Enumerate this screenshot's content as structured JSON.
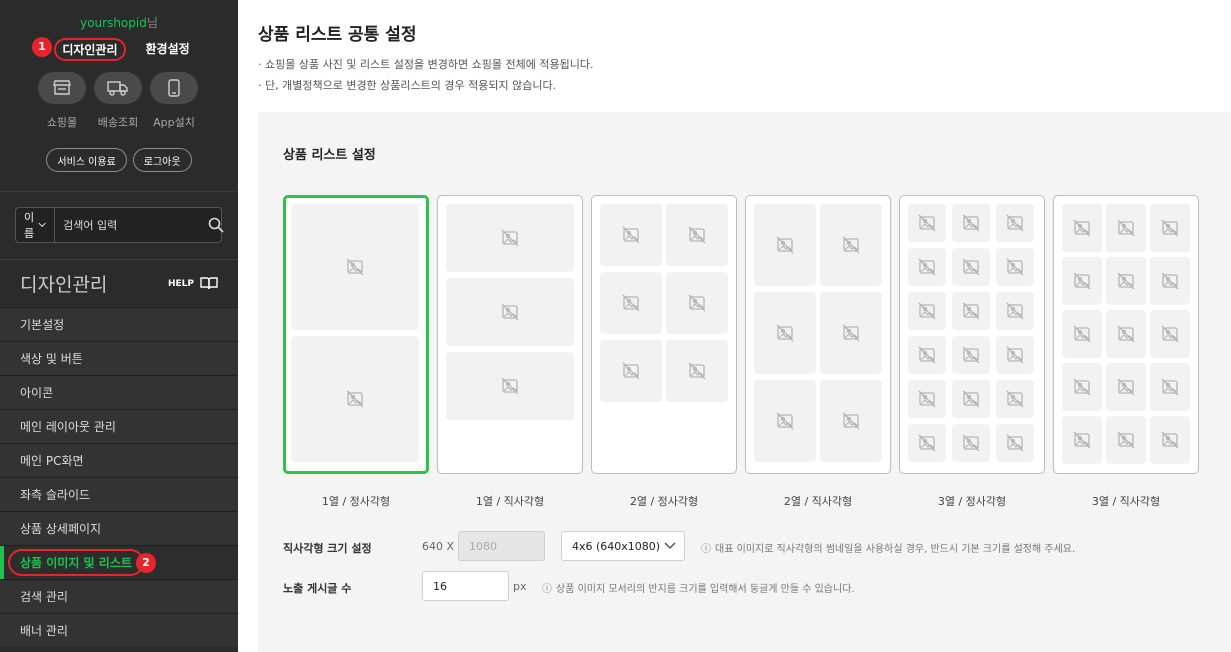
{
  "sidebar": {
    "username": "yourshopid",
    "username_suffix": "님",
    "tabs": [
      {
        "label": "디자인관리",
        "badge": "1"
      },
      {
        "label": "환경설정"
      }
    ],
    "quick": [
      {
        "icon": "shop-icon",
        "label": "쇼핑몰"
      },
      {
        "icon": "truck-icon",
        "label": "배송조회"
      },
      {
        "icon": "phone-icon",
        "label": "App설치"
      }
    ],
    "pills": [
      "서비스 이용료",
      "로그아웃"
    ],
    "search": {
      "select": "이름",
      "placeholder": "검색어 입력"
    },
    "section_title": "디자인관리",
    "help_label": "HELP",
    "menu": [
      {
        "label": "기본설정"
      },
      {
        "label": "색상 및 버튼"
      },
      {
        "label": "아이콘"
      },
      {
        "label": "메인 레이아웃 관리"
      },
      {
        "label": "메인 PC화면"
      },
      {
        "label": "좌측 슬라이드"
      },
      {
        "label": "상품 상세페이지"
      },
      {
        "label": "상품 이미지 및 리스트",
        "badge": "2"
      },
      {
        "label": "검색 관리"
      },
      {
        "label": "배너 관리"
      }
    ]
  },
  "main": {
    "title": "상품 리스트 공통 설정",
    "descriptions": [
      "· 쇼핑몰 상품 사진 및 리스트 설정을 변경하면 쇼핑몰 전체에 적용됩니다.",
      "· 단, 개별정책으로 변경한 상품리스트의 경우 적용되지 않습니다."
    ],
    "panel_title": "상품 리스트 설정",
    "layouts": [
      {
        "label": "1열 / 정사각형",
        "selected": true
      },
      {
        "label": "1열 / 직사각형",
        "selected": false
      },
      {
        "label": "2열 / 정사각형",
        "selected": false
      },
      {
        "label": "2열 / 직사각형",
        "selected": false
      },
      {
        "label": "3열 / 정사각형",
        "selected": false
      },
      {
        "label": "3열 / 직사각형",
        "selected": false
      }
    ],
    "rect_size": {
      "label": "직사각형 크기 설정",
      "width_text": "640 X",
      "height_value": "1080",
      "select_value": "4x6 (640x1080)",
      "hint": "대표 이미지로 직사각형의 썸네일을 사용하실 경우, 반드시 기본 크기를 설정해 주세요."
    },
    "post_count": {
      "label": "노출 게시글 수",
      "value": "16",
      "unit": "px",
      "hint": "상품 이미지 모서리의 반지름 크기를 입력해서 둥글게 만들 수 있습니다."
    }
  },
  "colors": {
    "accent": "#2fc14a",
    "highlight": "#e8242b",
    "sidebar": "#2b2b2b"
  }
}
